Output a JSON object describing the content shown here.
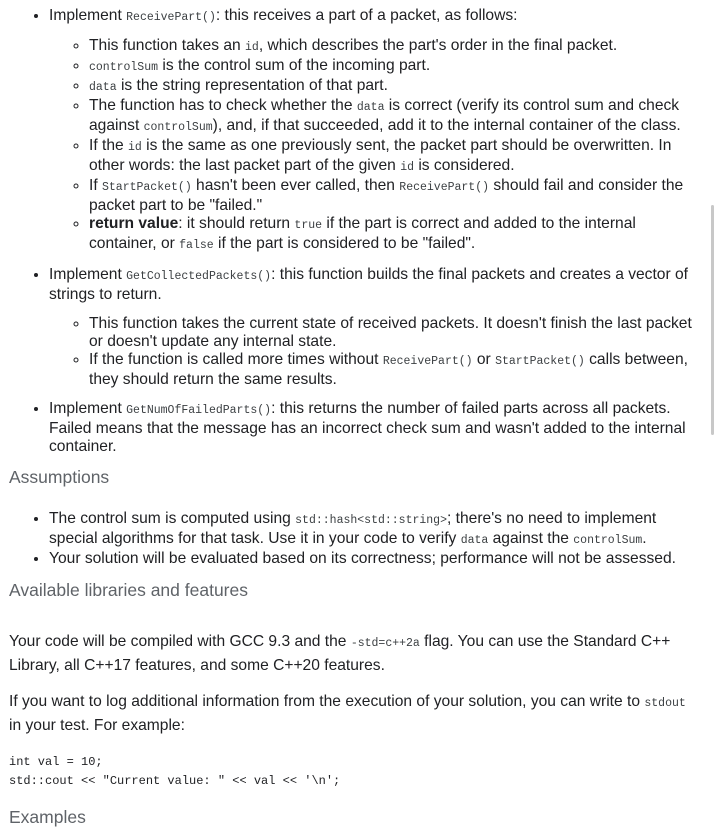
{
  "receive": {
    "pre": "Implement ",
    "fn": "ReceivePart()",
    "post": ": this receives a part of a packet, as follows:",
    "b1": {
      "a": "This function takes an ",
      "c": "id",
      "b": ", which describes the part's order in the final packet."
    },
    "b2": {
      "c": "controlSum",
      "b": " is the control sum of the incoming part."
    },
    "b3": {
      "c": "data",
      "b": " is the string representation of that part."
    },
    "b4": {
      "a": "The function has to check whether the ",
      "c1": "data",
      "b": " is correct (verify its control sum and check against ",
      "c2": "controlSum",
      "d": "), and, if that succeeded, add it to the internal container of the class."
    },
    "b5": {
      "a": "If the ",
      "c1": "id",
      "b": " is the same as one previously sent, the packet part should be overwritten. In other words: the last packet part of the given ",
      "c2": "id",
      "d": " is considered."
    },
    "b6": {
      "a": "If ",
      "c1": "StartPacket()",
      "b": " hasn't been ever called, then ",
      "c2": "ReceivePart()",
      "d": " should fail and consider the packet part to be \"failed.\""
    },
    "b7": {
      "strong": "return value",
      "a": ": it should return ",
      "c1": "true",
      "b": " if the part is correct and added to the internal container, or ",
      "c2": "false",
      "d": " if the part is considered to be \"failed\"."
    }
  },
  "collected": {
    "pre": "Implement ",
    "fn": "GetCollectedPackets()",
    "post": ": this function builds the final packets and creates a vector of strings to return.",
    "b1": "This function takes the current state of received packets. It doesn't finish the last packet or doesn't update any internal state.",
    "b2": {
      "a": "If the function is called more times without ",
      "c1": "ReceivePart()",
      "b": " or ",
      "c2": "StartPacket()",
      "d": " calls between, they should return the same results."
    }
  },
  "failed": {
    "pre": "Implement ",
    "fn": "GetNumOfFailedParts()",
    "post": ": this returns the number of failed parts across all packets. Failed means that the message has an incorrect check sum and wasn't added to the internal container."
  },
  "assumptions": {
    "heading": "Assumptions",
    "b1": {
      "a": "The control sum is computed using ",
      "c1": "std::hash<std::string>",
      "b": "; there's no need to implement special algorithms for that task. Use it in your code to verify ",
      "c2": "data",
      "d": " against the ",
      "c3": "controlSum",
      "e": "."
    },
    "b2": "Your solution will be evaluated based on its correctness; performance will not be assessed."
  },
  "libraries": {
    "heading": "Available libraries and features",
    "p1": {
      "a": "Your code will be compiled with GCC 9.3 and the ",
      "c": "-std=c++2a",
      "b": " flag. You can use the Standard C++ Library, all C++17 features, and some C++20 features."
    },
    "p2": {
      "a": "If you want to log additional information from the execution of your solution, you can write to ",
      "c": "stdout",
      "b": " in your test. For example:"
    },
    "code": [
      "int val = 10;",
      "std::cout << \"Current value: \" << val << '\\n';"
    ]
  },
  "examples": {
    "heading": "Examples"
  }
}
